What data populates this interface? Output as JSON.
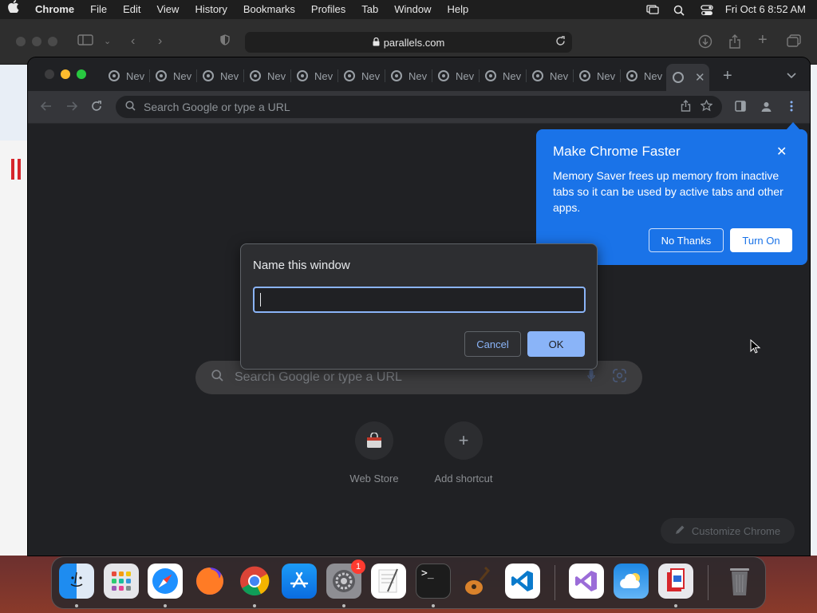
{
  "menubar": {
    "app_name": "Chrome",
    "items": [
      "File",
      "Edit",
      "View",
      "History",
      "Bookmarks",
      "Profiles",
      "Tab",
      "Window",
      "Help"
    ],
    "datetime": "Fri Oct 6  8:52 AM"
  },
  "safari": {
    "url": "parallels.com"
  },
  "chrome": {
    "tab_title": "Nev",
    "tab_count_visible": 13,
    "omnibox_placeholder": "Search Google or type a URL"
  },
  "ntp": {
    "search_placeholder": "Search Google or type a URL",
    "shortcuts": [
      {
        "label": "Web Store"
      },
      {
        "label": "Add shortcut"
      }
    ],
    "customize_label": "Customize Chrome"
  },
  "memory_bubble": {
    "title": "Make Chrome Faster",
    "body": "Memory Saver frees up memory from inactive tabs so it can be used by active tabs and other apps.",
    "no_thanks": "No Thanks",
    "turn_on": "Turn On"
  },
  "dialog": {
    "title": "Name this window",
    "input_value": "",
    "cancel": "Cancel",
    "ok": "OK"
  },
  "dock": {
    "badge_settings": "1",
    "apps": [
      "finder",
      "launchpad",
      "safari",
      "firefox",
      "chrome",
      "app-store",
      "system-settings",
      "textedit",
      "terminal",
      "garageband",
      "vscode",
      "visual-studio",
      "weather",
      "parallels",
      "trash"
    ]
  },
  "colors": {
    "bubble_blue": "#1a73e8",
    "dialog_accent": "#8ab4f8",
    "chrome_dark": "#202124"
  }
}
